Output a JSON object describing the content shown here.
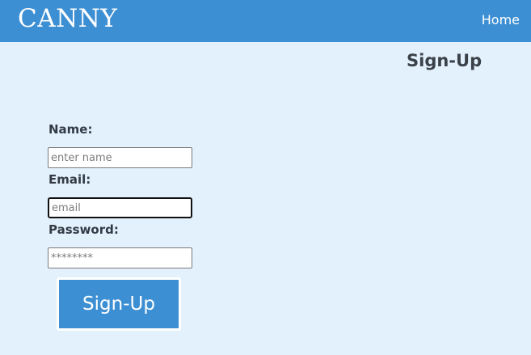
{
  "header": {
    "brand": "CANNY",
    "nav_home": "Home"
  },
  "page": {
    "title": "Sign-Up"
  },
  "form": {
    "name_label": "Name:",
    "name_value": "",
    "name_placeholder": "enter name",
    "email_label": "Email:",
    "email_value": "",
    "email_placeholder": "email",
    "password_label": "Password:",
    "password_value": "",
    "password_placeholder": "********",
    "submit_label": "Sign-Up"
  },
  "colors": {
    "header_bg": "#3d8fd3",
    "page_bg": "#e3f1fd",
    "button_bg": "#3d8fd3",
    "text": "#333b45"
  }
}
